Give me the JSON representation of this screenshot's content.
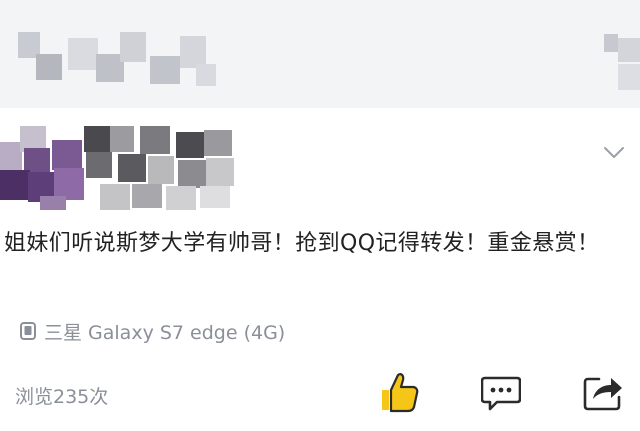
{
  "post": {
    "content": "姐妹们听说斯梦大学有帅哥！抢到QQ记得转发！重金悬赏！",
    "device": "三星 Galaxy S7 edge (4G)",
    "views": "浏览235次"
  },
  "icons": {
    "more": "chevron-down-icon",
    "device": "phone-icon",
    "like": "thumbs-up-icon",
    "comment": "comment-icon",
    "share": "share-icon"
  },
  "colors": {
    "header_bg": "#f3f4f6",
    "text": "#222222",
    "meta": "#8a8f99",
    "like": "#f5c518"
  }
}
